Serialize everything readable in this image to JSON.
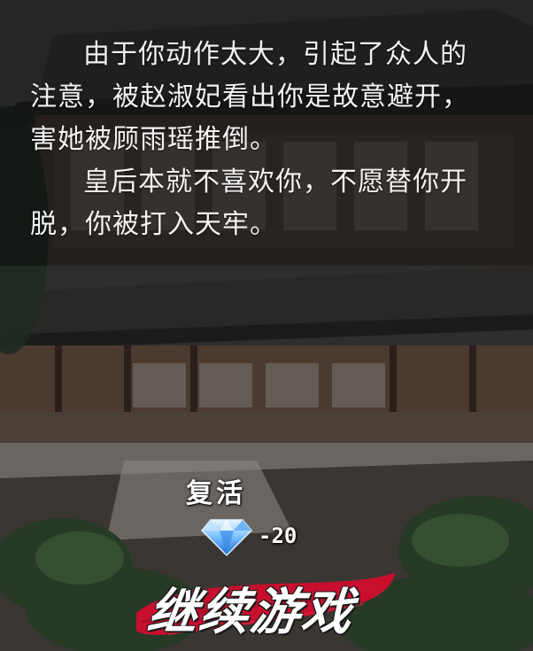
{
  "story": {
    "paragraphs": [
      "由于你动作太大，引起了众人的注意，被赵淑妃看出你是故意避开，害她被顾雨瑶推倒。",
      "皇后本就不喜欢你，不愿替你开脱，你被打入天牢。"
    ]
  },
  "revive": {
    "label": "复活",
    "cost": "-20",
    "cost_icon": "diamond-icon"
  },
  "continue_button": {
    "label": "继续游戏",
    "accent_color": "#c8102e"
  },
  "scene": {
    "description_icon": "palace-background"
  }
}
